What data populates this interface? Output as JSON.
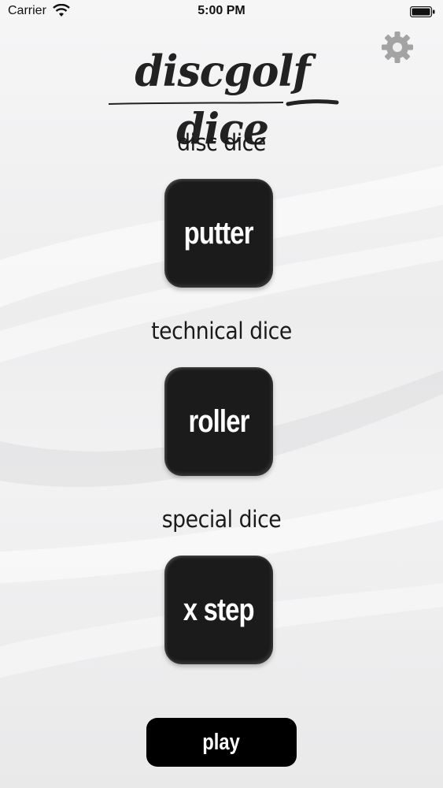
{
  "status_bar": {
    "carrier": "Carrier",
    "time": "5:00 PM"
  },
  "header": {
    "logo_text": "discgolf dice",
    "settings_icon": "gear-icon"
  },
  "sections": [
    {
      "label": "disc dice",
      "die_value": "putter"
    },
    {
      "label": "technical dice",
      "die_value": "roller"
    },
    {
      "label": "special dice",
      "die_value": "x step"
    }
  ],
  "play_button": {
    "label": "play"
  },
  "colors": {
    "die_background": "#1c1b1b",
    "play_background": "#000000",
    "gear": "#a3a3a3",
    "text": "#1a1a1a"
  }
}
